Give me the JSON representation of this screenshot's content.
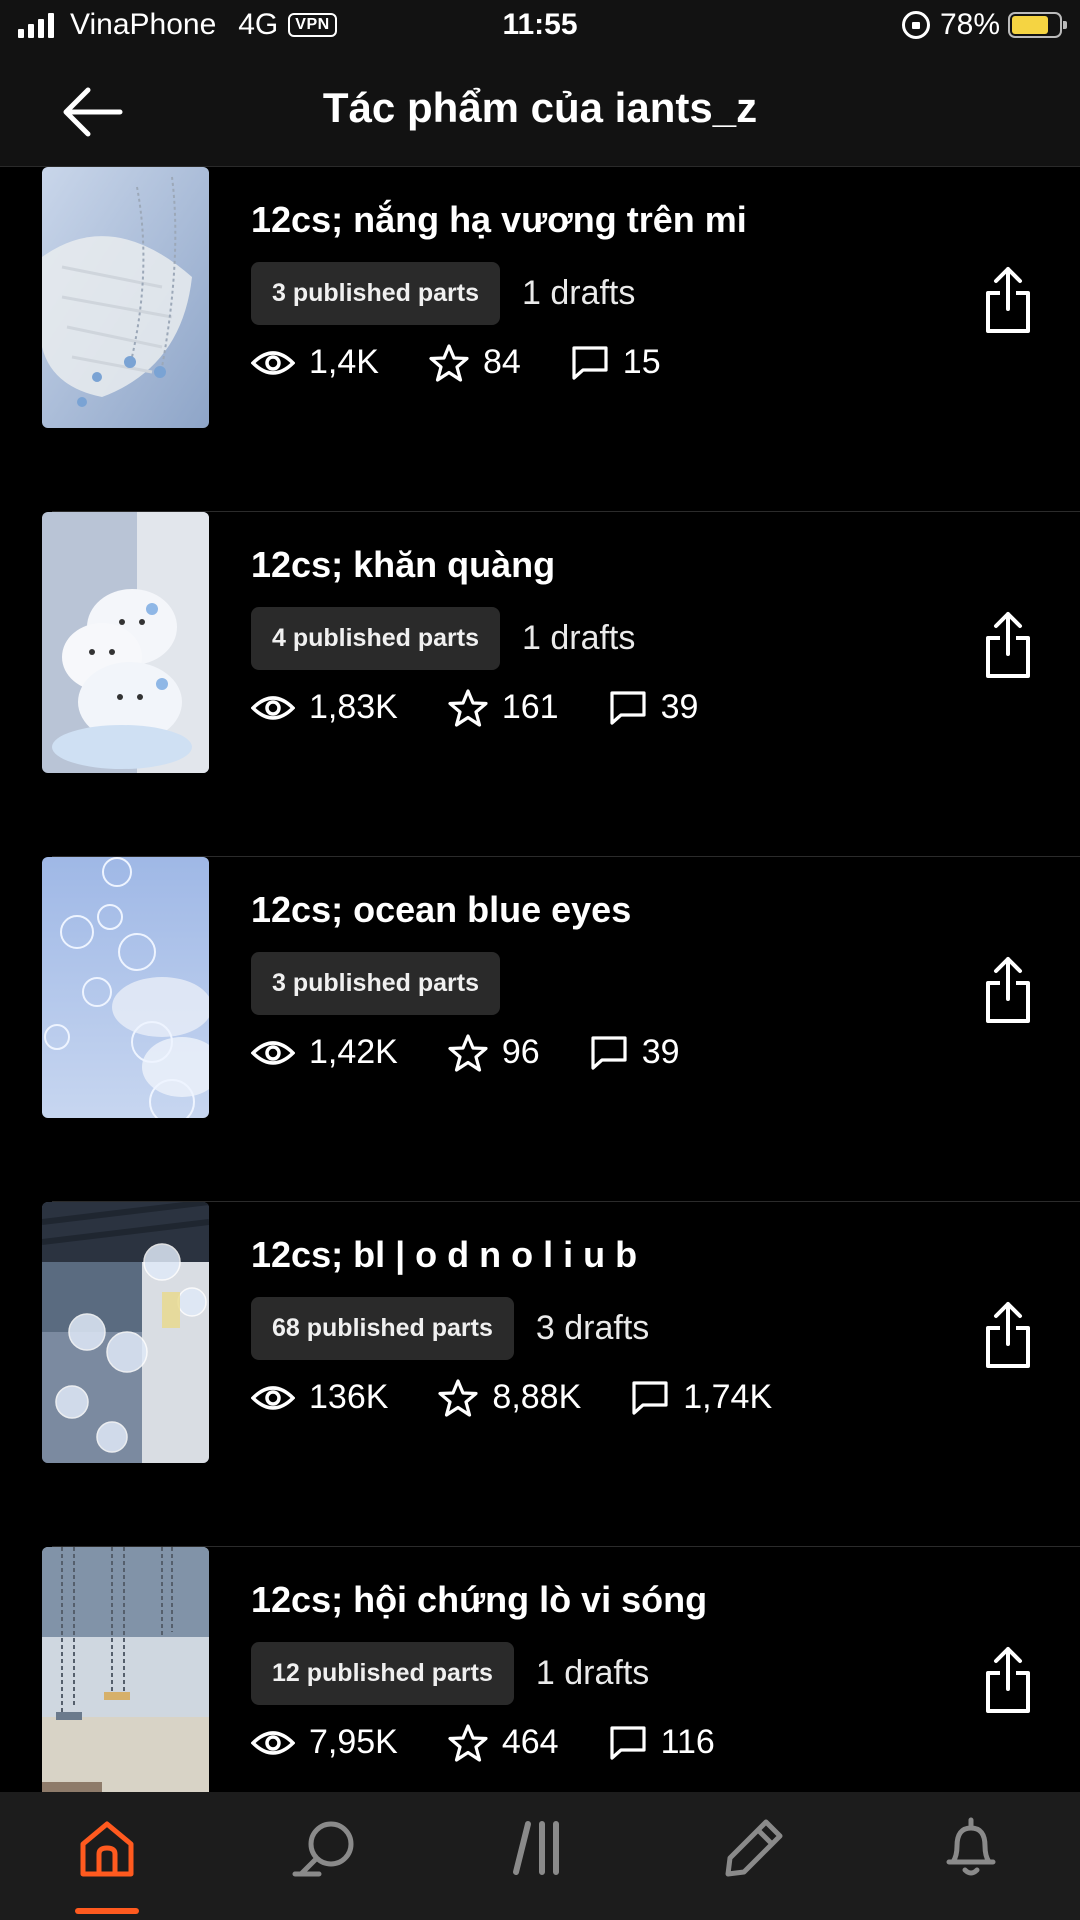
{
  "status_bar": {
    "carrier": "VinaPhone",
    "network": "4G",
    "vpn": "VPN",
    "time": "11:55",
    "battery_percent": "78%",
    "battery_level": 0.78,
    "battery_color": "#f5d442"
  },
  "header": {
    "back_icon": "arrow-left-icon",
    "title": "Tác phẩm của iants_z"
  },
  "stories": [
    {
      "title": "12cs; nắng hạ vương trên mi",
      "parts": "3 published parts",
      "drafts": "1 drafts",
      "views": "1,4K",
      "votes": "84",
      "comments": "15"
    },
    {
      "title": "12cs; khăn quàng",
      "parts": "4 published parts",
      "drafts": "1 drafts",
      "views": "1,83K",
      "votes": "161",
      "comments": "39"
    },
    {
      "title": "12cs; ocean blue eyes",
      "parts": "3 published parts",
      "drafts": "",
      "views": "1,42K",
      "votes": "96",
      "comments": "39"
    },
    {
      "title": "12cs; bl | o d n o l i u b",
      "parts": "68 published parts",
      "drafts": "3 drafts",
      "views": "136K",
      "votes": "8,88K",
      "comments": "1,74K"
    },
    {
      "title": "12cs; hội chứng lò vi sóng",
      "parts": "12 published parts",
      "drafts": "1 drafts",
      "views": "7,95K",
      "votes": "464",
      "comments": "116"
    }
  ],
  "bottom_nav": {
    "items": [
      "home-icon",
      "search-icon",
      "library-icon",
      "write-icon",
      "notifications-icon"
    ],
    "active": "home-icon",
    "accent_color": "#ff5a1f"
  }
}
